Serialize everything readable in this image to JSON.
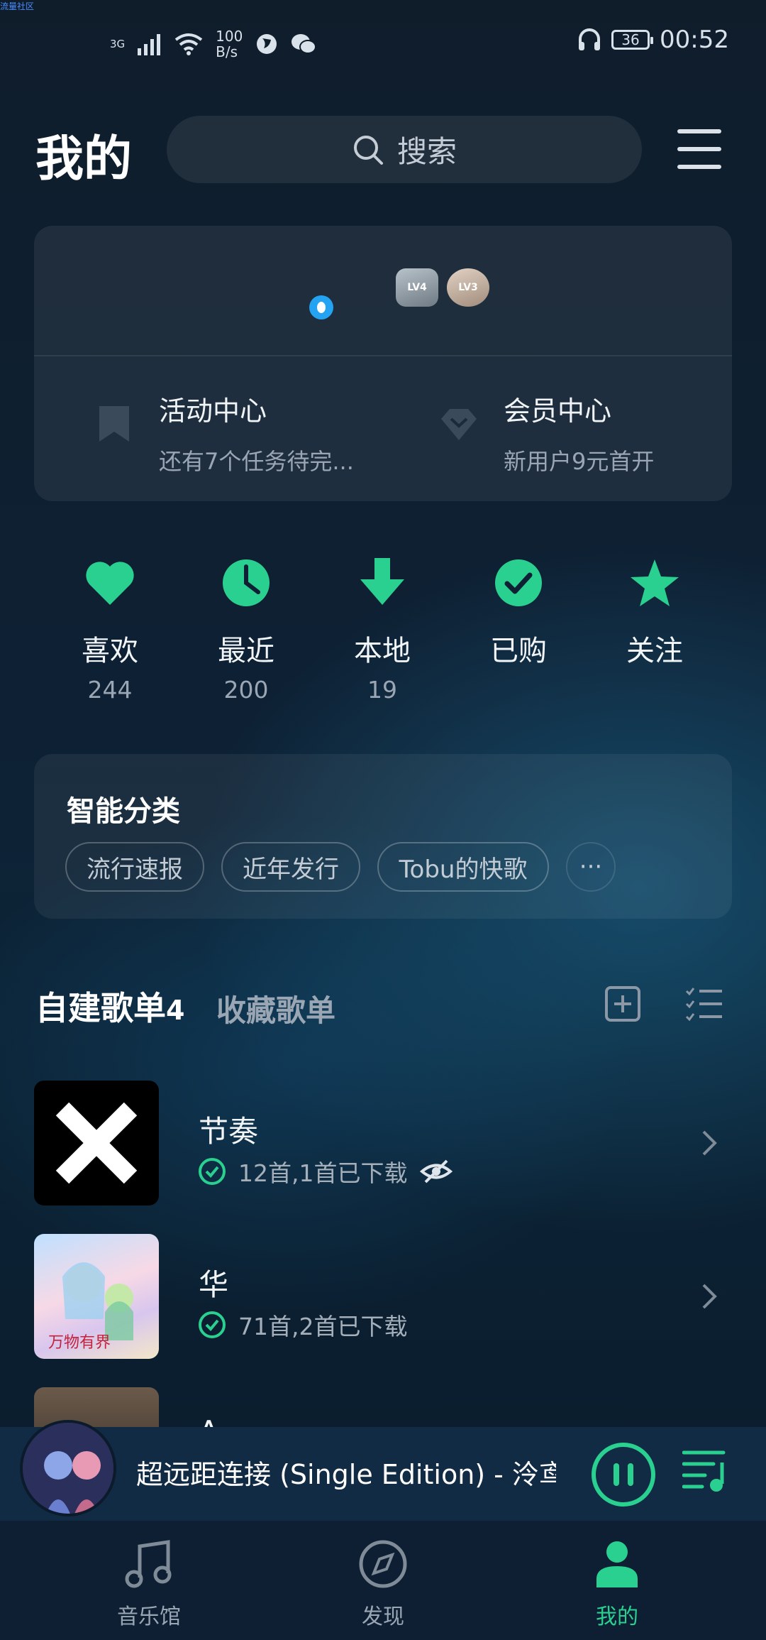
{
  "watermark": "流量社区",
  "status_bar": {
    "network": "3G",
    "speed_top": "100",
    "speed_bottom": "B/s",
    "battery": "36",
    "time": "00:52"
  },
  "header": {
    "title": "我的",
    "search_placeholder": "搜索"
  },
  "profile_card": {
    "level_badges": [
      "LV4",
      "LV3"
    ],
    "activity": {
      "title": "活动中心",
      "subtitle": "还有7个任务待完..."
    },
    "vip": {
      "title": "会员中心",
      "subtitle": "新用户9元首开"
    }
  },
  "quick_actions": [
    {
      "label": "喜欢",
      "count": "244",
      "icon": "heart-icon"
    },
    {
      "label": "最近",
      "count": "200",
      "icon": "clock-icon"
    },
    {
      "label": "本地",
      "count": "19",
      "icon": "download-icon"
    },
    {
      "label": "已购",
      "count": "",
      "icon": "check-circle-icon"
    },
    {
      "label": "关注",
      "count": "",
      "icon": "star-icon"
    }
  ],
  "smart_category": {
    "title": "智能分类",
    "chips": [
      "流行速报",
      "近年发行",
      "Tobu的快歌",
      "···"
    ]
  },
  "playlists": {
    "tab_created": "自建歌单",
    "tab_created_count": "4",
    "tab_collected": "收藏歌单",
    "items": [
      {
        "name": "节奏",
        "meta": "12首,1首已下载",
        "hidden_icon": "eye-off-icon"
      },
      {
        "name": "华",
        "meta": "71首,2首已下载"
      },
      {
        "name": "A",
        "meta": ""
      }
    ]
  },
  "now_playing": {
    "title": "超远距连接 (Single Edition) - 泠鸢y"
  },
  "bottom_nav": [
    {
      "label": "音乐馆",
      "icon": "music-note-icon"
    },
    {
      "label": "发现",
      "icon": "compass-icon"
    },
    {
      "label": "我的",
      "icon": "person-icon"
    }
  ],
  "colors": {
    "accent": "#2ad08f",
    "background": "#0e2033"
  }
}
